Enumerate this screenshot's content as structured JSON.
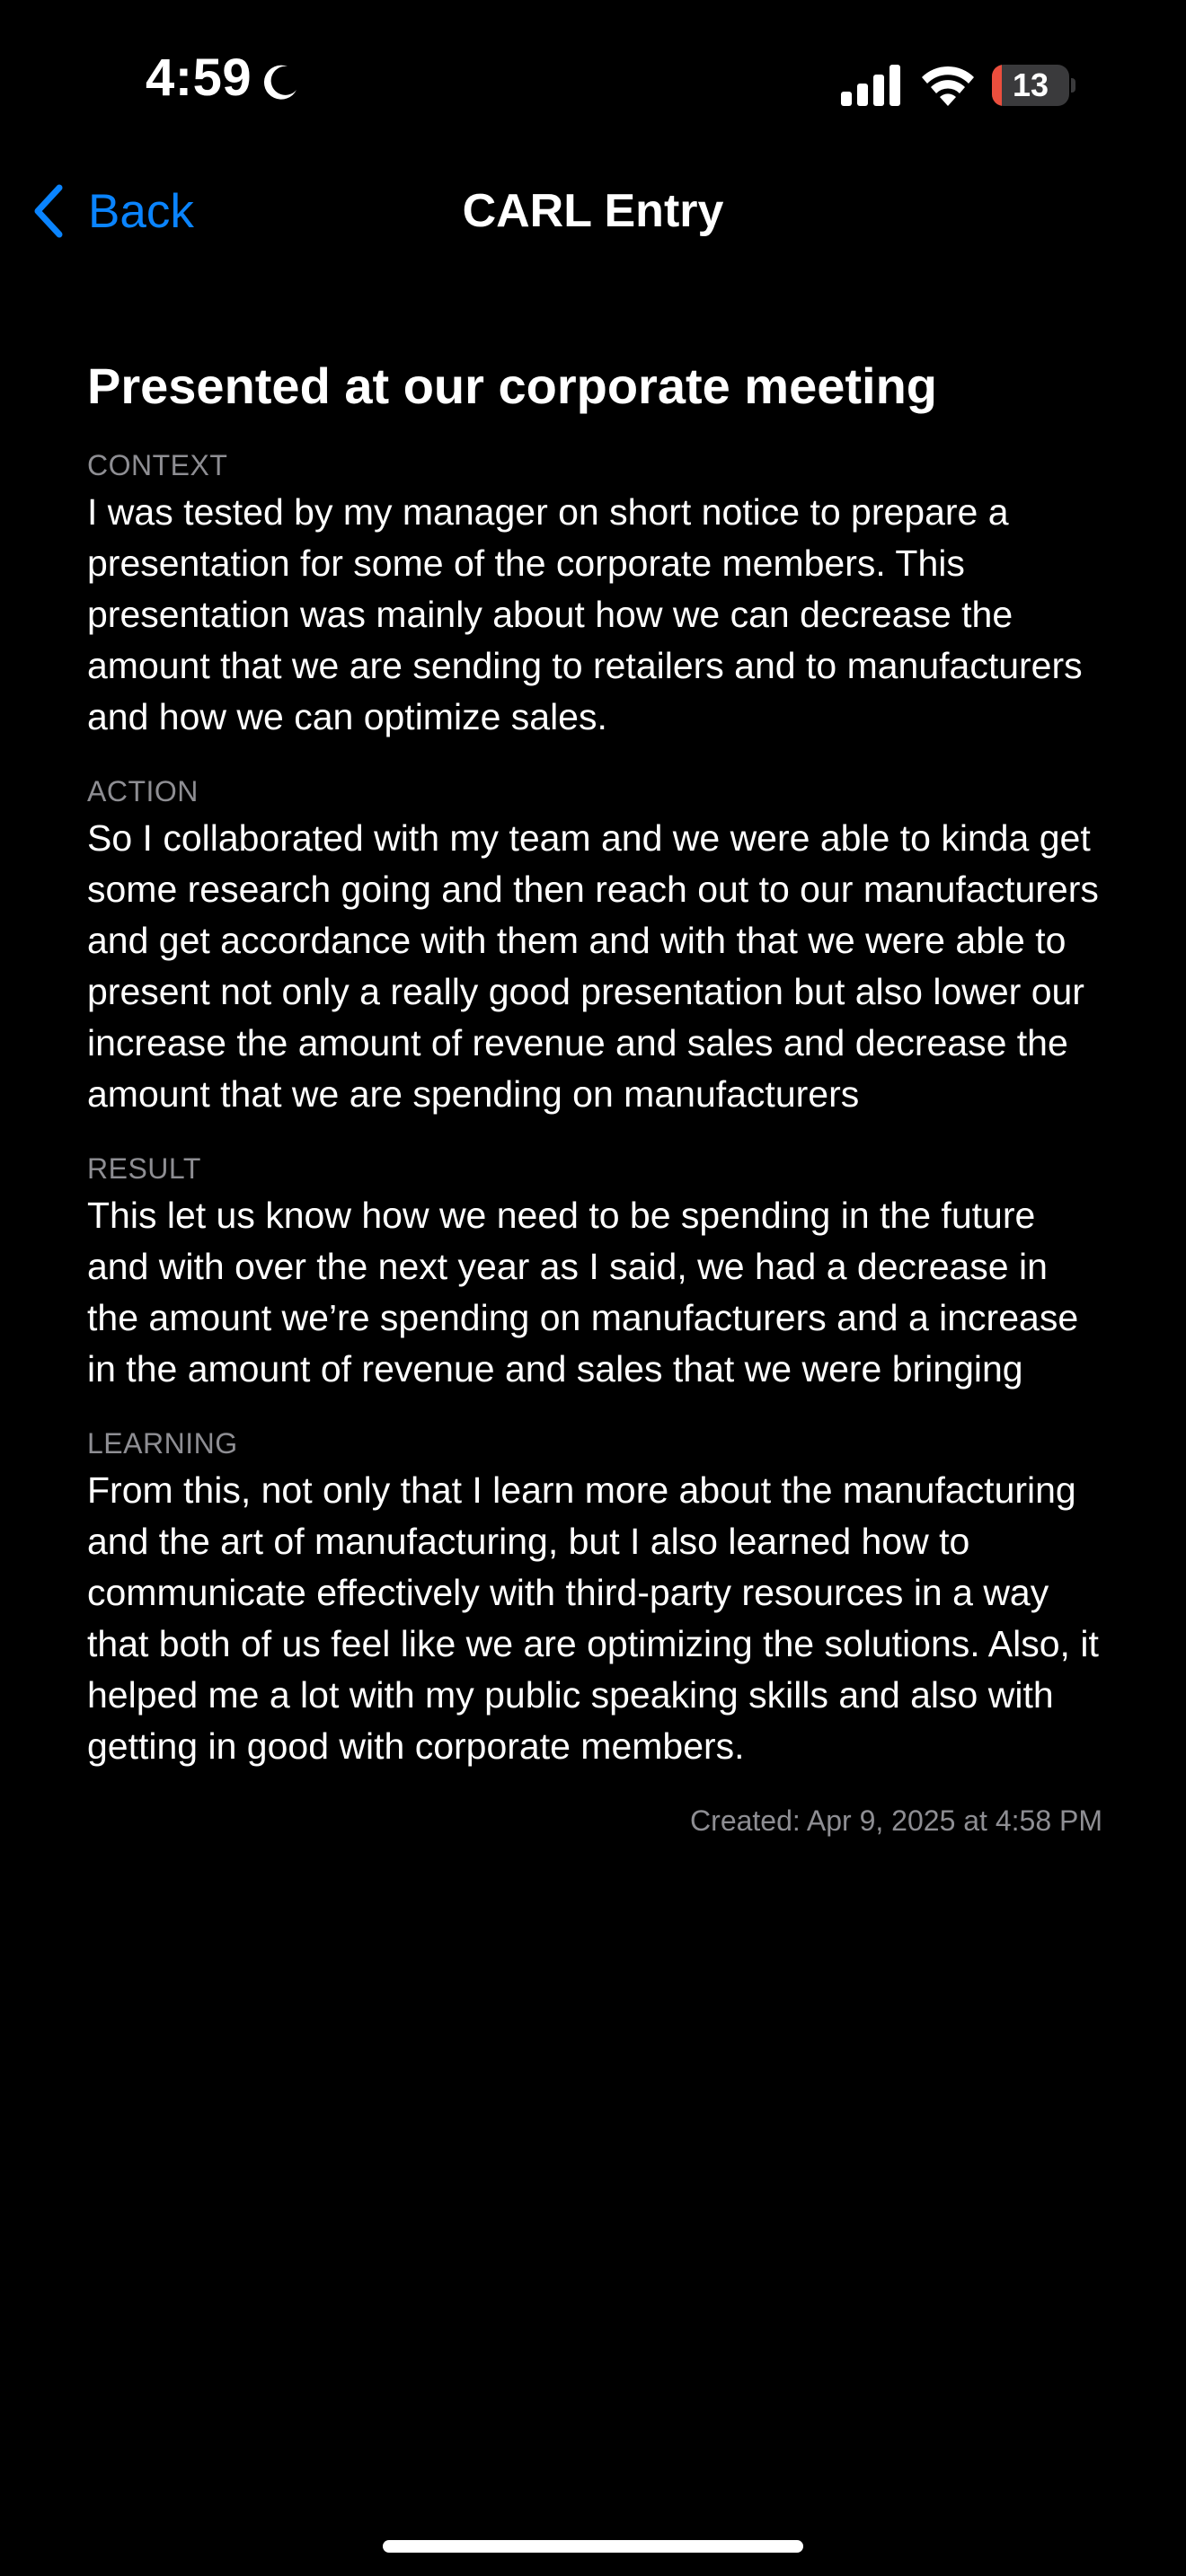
{
  "status_bar": {
    "time": "4:59",
    "battery_level": "13",
    "battery_fraction": 0.13,
    "focus_icon": "moon-icon",
    "icons": [
      "cellular-signal-icon",
      "wifi-icon",
      "battery-icon"
    ],
    "battery_color": "#eb4e3d"
  },
  "nav": {
    "back_label": "Back",
    "title": "CARL Entry",
    "accent_color": "#0a84ff"
  },
  "entry": {
    "title": "Presented at our corporate meeting",
    "sections": [
      {
        "label": "CONTEXT",
        "text": "I was tested by my manager on short notice to prepare a presentation for some of the corporate members. This presentation was mainly about how we can decrease the amount that we are sending to retailers and to manufacturers and how we can optimize sales."
      },
      {
        "label": "ACTION",
        "text": "So I collaborated with my team and we were able to kinda get some research going and then reach out to our manufacturers and get accordance with them and with that we were able to present not only a really good presentation but also lower our increase the amount of revenue and sales and decrease the amount that we are spending on manufacturers"
      },
      {
        "label": "RESULT",
        "text": "This let us know how we need to be spending in the future and with over the next year as I said, we had a decrease in the amount we’re spending on manufacturers and a increase in the amount of revenue and sales that we were bringing"
      },
      {
        "label": "LEARNING",
        "text": "From this, not only that I learn more about the manufacturing and the art of manufacturing, but I also learned how to communicate effectively with third-party resources in a way that both of us feel like we are optimizing the solutions. Also, it helped me a lot with my public speaking skills and also with getting in good with corporate members."
      }
    ],
    "created": "Created: Apr 9, 2025 at 4:58 PM"
  }
}
